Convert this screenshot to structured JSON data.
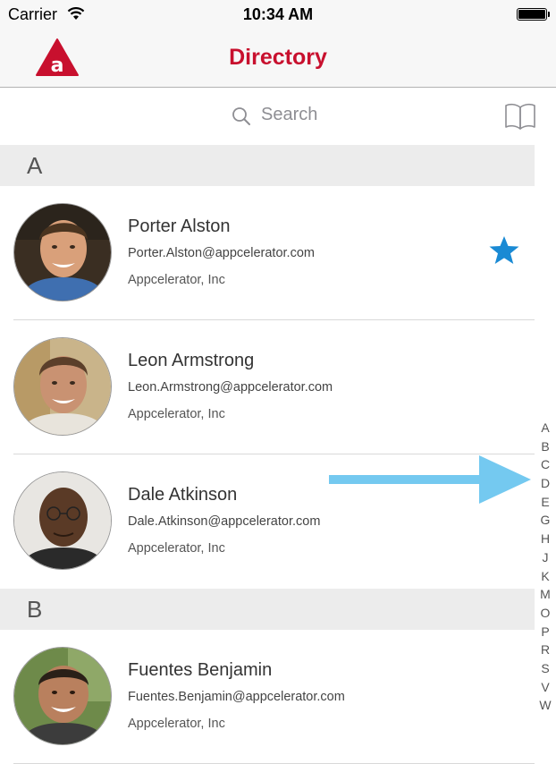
{
  "status_bar": {
    "carrier": "Carrier",
    "time": "10:34 AM"
  },
  "nav": {
    "title": "Directory",
    "logo_icon": "appcelerator-logo",
    "brand_color": "#c8102e"
  },
  "search": {
    "placeholder": "Search",
    "bookmark_icon": "book-icon"
  },
  "sections": [
    {
      "letter": "A",
      "contacts": [
        {
          "name": "Porter Alston",
          "email": "Porter.Alston@appcelerator.com",
          "company": "Appcelerator, Inc",
          "favorite": true
        },
        {
          "name": "Leon Armstrong",
          "email": "Leon.Armstrong@appcelerator.com",
          "company": "Appcelerator, Inc",
          "favorite": false
        },
        {
          "name": "Dale Atkinson",
          "email": "Dale.Atkinson@appcelerator.com",
          "company": "Appcelerator, Inc",
          "favorite": false
        }
      ]
    },
    {
      "letter": "B",
      "contacts": [
        {
          "name": "Fuentes Benjamin",
          "email": "Fuentes.Benjamin@appcelerator.com",
          "company": "Appcelerator, Inc",
          "favorite": false
        }
      ]
    }
  ],
  "index": [
    "A",
    "B",
    "C",
    "D",
    "E",
    "G",
    "H",
    "J",
    "K",
    "M",
    "O",
    "P",
    "R",
    "S",
    "V",
    "W"
  ],
  "colors": {
    "star": "#1a8ad4",
    "arrow": "#74c9f0",
    "section_header_bg": "#ececec"
  }
}
